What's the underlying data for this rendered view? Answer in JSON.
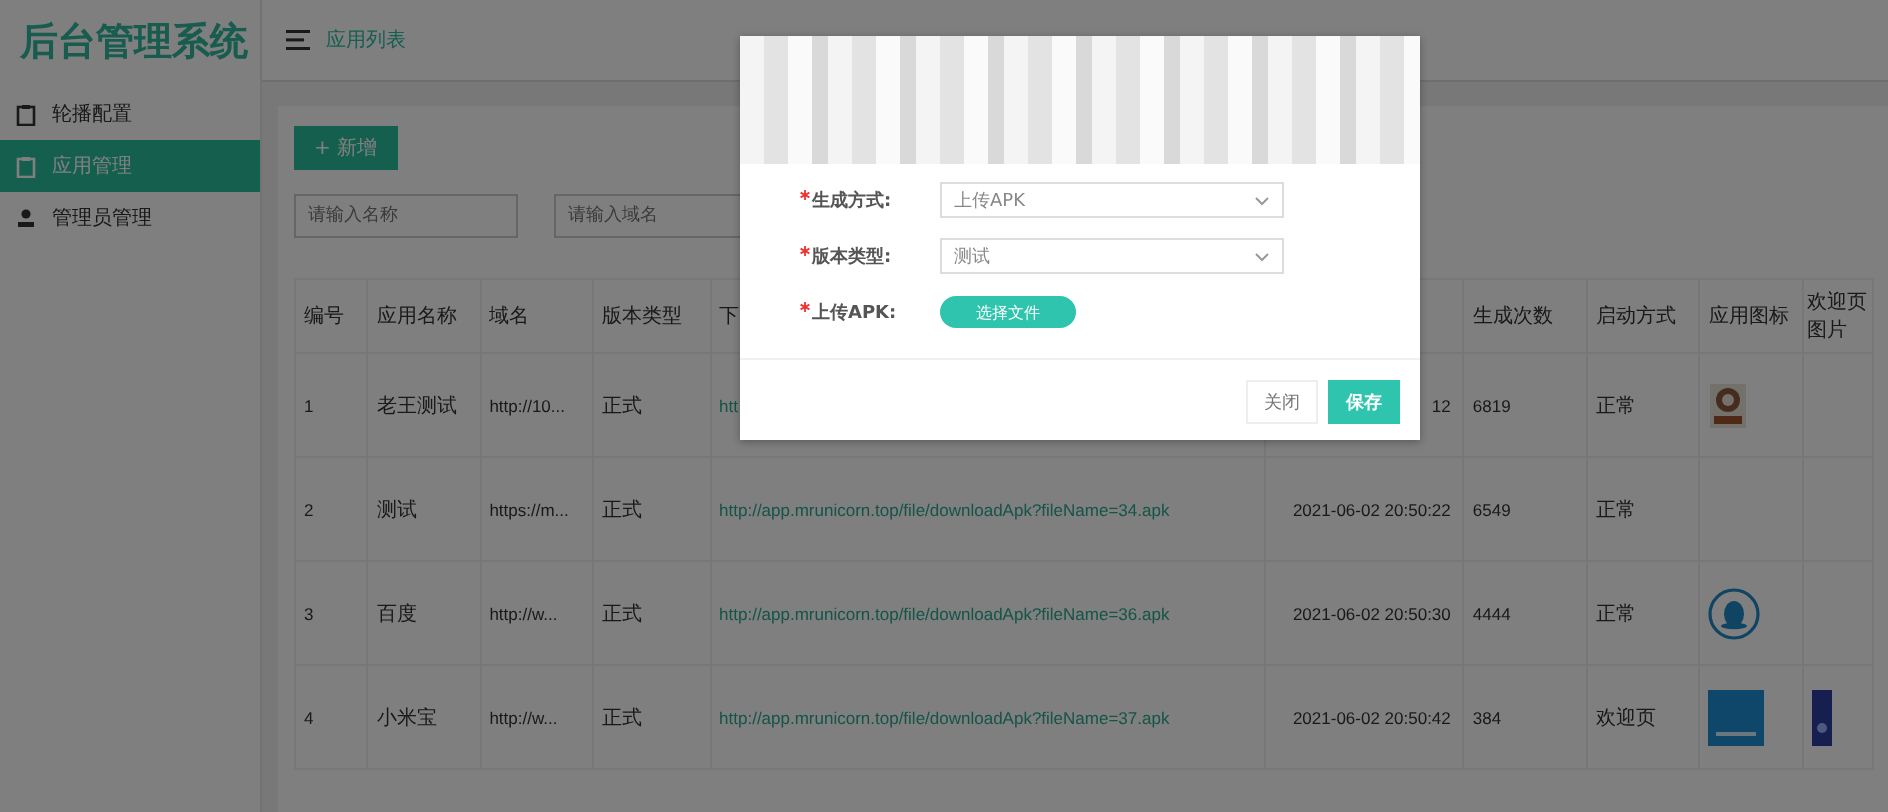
{
  "app_title": "后台管理系统",
  "sidebar": {
    "items": [
      {
        "label": "轮播配置",
        "selected": false
      },
      {
        "label": "应用管理",
        "selected": true
      },
      {
        "label": "管理员管理",
        "selected": false,
        "kind": "user"
      }
    ]
  },
  "header": {
    "breadcrumb": "应用列表"
  },
  "toolbar": {
    "add_button": "+ 新增"
  },
  "filters": [
    {
      "placeholder": "请输入名称"
    },
    {
      "placeholder": "请输入域名"
    }
  ],
  "table": {
    "columns": [
      {
        "label": "编号"
      },
      {
        "label": "应用名称"
      },
      {
        "label": "域名"
      },
      {
        "label": "版本类型"
      },
      {
        "label": "下"
      },
      {},
      {
        "label": "生成次数"
      },
      {
        "label": "启动方式"
      },
      {
        "label": "应用图标"
      },
      {
        "label": "欢迎页图片"
      }
    ],
    "rows": [
      {
        "id": "1",
        "name": "老王测试",
        "domain": "http://10...",
        "version": "正式",
        "link": "htt",
        "date": "12",
        "count": "6819",
        "launch": "正常",
        "kind": "image"
      },
      {
        "id": "2",
        "name": "测试",
        "domain": "https://m...",
        "version": "正式",
        "link": "http://app.mrunicorn.top/file/downloadApk?fileName=34.apk",
        "date": "2021-06-02 20:50:22",
        "count": "6549",
        "launch": "正常",
        "kind": "plain"
      },
      {
        "id": "3",
        "name": "百度",
        "domain": "http://w...",
        "version": "正式",
        "link": "http://app.mrunicorn.top/file/downloadApk?fileName=36.apk",
        "date": "2021-06-02 20:50:30",
        "count": "4444",
        "launch": "正常",
        "kind": "image"
      },
      {
        "id": "4",
        "name": "小米宝",
        "domain": "http://w...",
        "version": "正式",
        "link": "http://app.mrunicorn.top/file/downloadApk?fileName=37.apk",
        "date": "2021-06-02 20:50:42",
        "count": "384",
        "launch": "欢迎页",
        "kind": "image"
      }
    ]
  },
  "dialog": {
    "fields": [
      {
        "label": "生成方式:",
        "required": true,
        "kind": "select",
        "value": "上传APK"
      },
      {
        "label": "版本类型:",
        "required": true,
        "kind": "select",
        "value": "测试"
      },
      {
        "label": "上传APK:",
        "required": true,
        "kind": "file",
        "button": "选择文件"
      }
    ],
    "buttons": [
      {
        "label": "关闭",
        "kind": "plain"
      },
      {
        "label": "保存",
        "kind": "primary"
      }
    ]
  }
}
